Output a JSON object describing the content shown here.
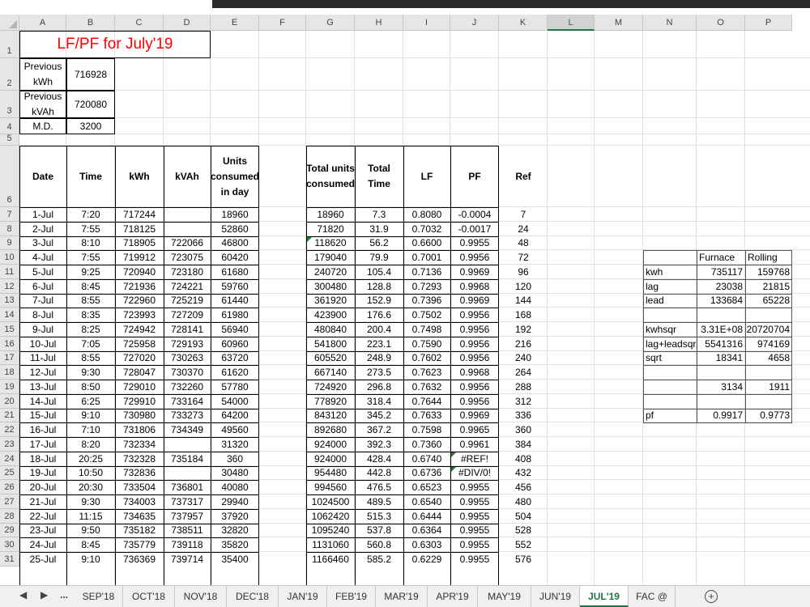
{
  "columns": [
    "A",
    "B",
    "C",
    "D",
    "E",
    "F",
    "G",
    "H",
    "I",
    "J",
    "K",
    "L",
    "M",
    "N",
    "O",
    "P"
  ],
  "active_column": "L",
  "rows": [
    "1",
    "2",
    "3",
    "4",
    "5",
    "6",
    "7",
    "8",
    "9",
    "10",
    "11",
    "12",
    "13",
    "14",
    "15",
    "16",
    "17",
    "18",
    "19",
    "20",
    "21",
    "22",
    "23",
    "24",
    "25",
    "26",
    "27",
    "28",
    "29",
    "30",
    "31"
  ],
  "title": "LF/PF for July'19",
  "info": [
    {
      "label": "Previous kWh",
      "value": "716928"
    },
    {
      "label": "Previous kVAh",
      "value": "720080"
    },
    {
      "label": "M.D.",
      "value": "3200"
    }
  ],
  "headers_left": [
    "Date",
    "Time",
    "kWh",
    "kVAh",
    "Units consumed in day"
  ],
  "headers_right": [
    "Total units consumed",
    "Total Time",
    "LF",
    "PF",
    "Ref"
  ],
  "data_rows": [
    [
      "1-Jul",
      "7:20",
      "717244",
      "",
      "18960",
      "18960",
      "7.3",
      "0.8080",
      "-0.0004",
      "7"
    ],
    [
      "2-Jul",
      "7:55",
      "718125",
      "",
      "52860",
      "71820",
      "31.9",
      "0.7032",
      "-0.0017",
      "24"
    ],
    [
      "3-Jul",
      "8:10",
      "718905",
      "722066",
      "46800",
      "118620",
      "56.2",
      "0.6600",
      "0.9955",
      "48"
    ],
    [
      "4-Jul",
      "7:55",
      "719912",
      "723075",
      "60420",
      "179040",
      "79.9",
      "0.7001",
      "0.9956",
      "72"
    ],
    [
      "5-Jul",
      "9:25",
      "720940",
      "723180",
      "61680",
      "240720",
      "105.4",
      "0.7136",
      "0.9969",
      "96"
    ],
    [
      "6-Jul",
      "8:45",
      "721936",
      "724221",
      "59760",
      "300480",
      "128.8",
      "0.7293",
      "0.9968",
      "120"
    ],
    [
      "7-Jul",
      "8:55",
      "722960",
      "725219",
      "61440",
      "361920",
      "152.9",
      "0.7396",
      "0.9969",
      "144"
    ],
    [
      "8-Jul",
      "8:35",
      "723993",
      "727209",
      "61980",
      "423900",
      "176.6",
      "0.7502",
      "0.9956",
      "168"
    ],
    [
      "9-Jul",
      "8:25",
      "724942",
      "728141",
      "56940",
      "480840",
      "200.4",
      "0.7498",
      "0.9956",
      "192"
    ],
    [
      "10-Jul",
      "7:05",
      "725958",
      "729193",
      "60960",
      "541800",
      "223.1",
      "0.7590",
      "0.9956",
      "216"
    ],
    [
      "11-Jul",
      "8:55",
      "727020",
      "730263",
      "63720",
      "605520",
      "248.9",
      "0.7602",
      "0.9956",
      "240"
    ],
    [
      "12-Jul",
      "9:30",
      "728047",
      "730370",
      "61620",
      "667140",
      "273.5",
      "0.7623",
      "0.9968",
      "264"
    ],
    [
      "13-Jul",
      "8:50",
      "729010",
      "732260",
      "57780",
      "724920",
      "296.8",
      "0.7632",
      "0.9956",
      "288"
    ],
    [
      "14-Jul",
      "6:25",
      "729910",
      "733164",
      "54000",
      "778920",
      "318.4",
      "0.7644",
      "0.9956",
      "312"
    ],
    [
      "15-Jul",
      "9:10",
      "730980",
      "733273",
      "64200",
      "843120",
      "345.2",
      "0.7633",
      "0.9969",
      "336"
    ],
    [
      "16-Jul",
      "7:10",
      "731806",
      "734349",
      "49560",
      "892680",
      "367.2",
      "0.7598",
      "0.9965",
      "360"
    ],
    [
      "17-Jul",
      "8:20",
      "732334",
      "",
      "31320",
      "924000",
      "392.3",
      "0.7360",
      "0.9961",
      "384"
    ],
    [
      "18-Jul",
      "20:25",
      "732328",
      "735184",
      "360",
      "924000",
      "428.4",
      "0.6740",
      "#REF!",
      "408"
    ],
    [
      "19-Jul",
      "10:50",
      "732836",
      "",
      "30480",
      "954480",
      "442.8",
      "0.6736",
      "#DIV/0!",
      "432"
    ],
    [
      "20-Jul",
      "20:30",
      "733504",
      "736801",
      "40080",
      "994560",
      "476.5",
      "0.6523",
      "0.9955",
      "456"
    ],
    [
      "21-Jul",
      "9:30",
      "734003",
      "737317",
      "29940",
      "1024500",
      "489.5",
      "0.6540",
      "0.9955",
      "480"
    ],
    [
      "22-Jul",
      "11:15",
      "734635",
      "737957",
      "37920",
      "1062420",
      "515.3",
      "0.6444",
      "0.9955",
      "504"
    ],
    [
      "23-Jul",
      "9:50",
      "735182",
      "738511",
      "32820",
      "1095240",
      "537.8",
      "0.6364",
      "0.9955",
      "528"
    ],
    [
      "24-Jul",
      "8:45",
      "735779",
      "739118",
      "35820",
      "1131060",
      "560.8",
      "0.6303",
      "0.9955",
      "552"
    ],
    [
      "25-Jul",
      "9:10",
      "736369",
      "739714",
      "35400",
      "1166460",
      "585.2",
      "0.6229",
      "0.9955",
      "576"
    ]
  ],
  "side_table": {
    "col_headers": [
      "Furnace",
      "Rolling"
    ],
    "rows": [
      {
        "label": "kwh",
        "furnace": "735117",
        "rolling": "159768"
      },
      {
        "label": "lag",
        "furnace": "23038",
        "rolling": "21815"
      },
      {
        "label": "lead",
        "furnace": "133684",
        "rolling": "65228"
      },
      {
        "label": "",
        "furnace": "",
        "rolling": ""
      },
      {
        "label": "kwhsqr",
        "furnace": "3.31E+08",
        "rolling": "20720704"
      },
      {
        "label": "lag+leadsqr",
        "furnace": "5541316",
        "rolling": "974169"
      },
      {
        "label": "sqrt",
        "furnace": "18341",
        "rolling": "4658"
      },
      {
        "label": "",
        "furnace": "",
        "rolling": ""
      },
      {
        "label": "",
        "furnace": "3134",
        "rolling": "1911"
      },
      {
        "label": "",
        "furnace": "",
        "rolling": ""
      },
      {
        "label": "pf",
        "furnace": "0.9917",
        "rolling": "0.9773"
      }
    ]
  },
  "sheet_tabs": [
    "SEP'18",
    "OCT'18",
    "NOV'18",
    "DEC'18",
    "JAN'19",
    "FEB'19",
    "MAR'19",
    "APR'19",
    "MAY'19",
    "JUN'19",
    "JUL'19",
    "FAC @"
  ],
  "active_tab": "JUL'19",
  "nav": {
    "prev": "◀",
    "next": "▶",
    "more": "...",
    "add": "+"
  }
}
